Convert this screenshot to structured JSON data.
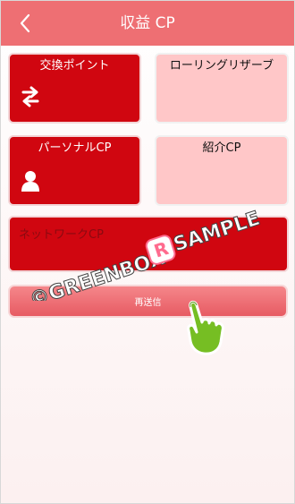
{
  "header": {
    "title": "収益 CP"
  },
  "cards": {
    "exchange_points": "交換ポイント",
    "rolling_reserve": "ローリングリザーブ",
    "personal_cp": "パーソナルCP",
    "referral_cp": "紹介CP",
    "network_cp": "ネットワークCP"
  },
  "actions": {
    "resend_label": "再送信"
  },
  "watermark": {
    "text": "©GREENBOX",
    "sample_text": "SAMPLE",
    "logo_letter": "R"
  },
  "colors": {
    "header": "#ee6f73",
    "red_card": "#d00610",
    "pink_card": "#ffc7c8",
    "button": "#e75b63"
  }
}
